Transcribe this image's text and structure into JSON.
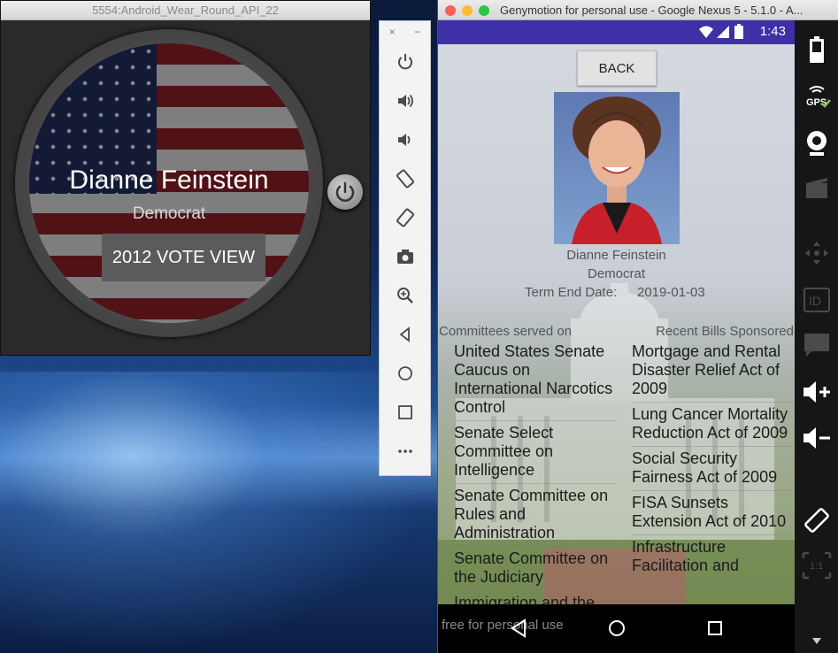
{
  "wear": {
    "window_title": "5554:Android_Wear_Round_API_22",
    "name": "Dianne Feinstein",
    "party": "Democrat",
    "vote_button": "2012 VOTE VIEW"
  },
  "toolbar": {
    "close": "×",
    "minimize": "−",
    "icons": [
      "power-icon",
      "volume-up-icon",
      "volume-down-icon",
      "rotate-left-icon",
      "rotate-right-icon",
      "camera-icon",
      "zoom-icon",
      "back-icon",
      "home-icon",
      "overview-icon",
      "more-icon"
    ]
  },
  "genymotion": {
    "window_title": "Genymotion for personal use - Google Nexus 5 - 5.1.0 - A...",
    "status_time": "1:43",
    "back_button": "BACK",
    "name": "Dianne Feinstein",
    "party": "Democrat",
    "term_label": "Term End Date:",
    "term_value": "2019-01-03",
    "committees_header": "Committees served on",
    "bills_header": "Recent Bills Sponsored",
    "committees": [
      "United States Senate Caucus on International Narcotics Control",
      "Senate Select Committee on Intelligence",
      "Senate Committee on Rules and Administration",
      "Senate Committee on the Judiciary",
      "Immigration and the"
    ],
    "bills": [
      "Mortgage and Rental Disaster Relief Act of 2009",
      "Lung Cancer Mortality Reduction Act of 2009",
      "Social Security Fairness Act of 2009",
      "FISA Sunsets Extension Act of 2010",
      "Infrastructure Facilitation and"
    ],
    "watermark": "free for personal use",
    "sidebar_icons": [
      "battery-icon",
      "gps-icon",
      "webcam-icon",
      "media-icon",
      "dpad-icon",
      "id-icon",
      "sms-icon",
      "volume-up-icon",
      "volume-down-icon",
      "rotate-icon",
      "pixel-perfect-icon"
    ],
    "sidebar_gps": "GPS",
    "sidebar_id": "ID",
    "sidebar_scale": "1:1"
  },
  "colors": {
    "status_bar": "#3d30a8",
    "flag_red": "#8c1f26",
    "flag_blue": "#1f2e5e"
  }
}
